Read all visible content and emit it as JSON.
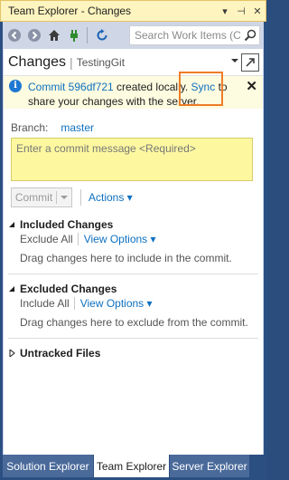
{
  "window": {
    "title": "Team Explorer - Changes",
    "controls": {
      "dropdown": "▾",
      "pin": "⊣",
      "close": "✕"
    }
  },
  "toolbar": {
    "buttons": [
      "back-icon",
      "forward-icon",
      "home-icon",
      "plug-icon",
      "refresh-icon"
    ],
    "search": {
      "placeholder": "Search Work Items (C",
      "icon": "search-icon"
    }
  },
  "header": {
    "page": "Changes",
    "separator": "|",
    "repo": "TestingGit"
  },
  "notification": {
    "prefix_link": "Commit 596df721",
    "middle": " created locally. ",
    "sync_link": "Sync",
    "suffix": " to share your changes with the server.",
    "close": "✕"
  },
  "branch": {
    "label": "Branch:",
    "value": "master"
  },
  "commit": {
    "placeholder": "Enter a commit message <Required>",
    "button": "Commit",
    "actions": "Actions ▾"
  },
  "included": {
    "title": "Included Changes",
    "exclude_all": "Exclude All",
    "view_options": "View Options ▾",
    "drop_text": "Drag changes here to include in the commit."
  },
  "excluded": {
    "title": "Excluded Changes",
    "include_all": "Include All",
    "view_options": "View Options ▾",
    "drop_text": "Drag changes here to exclude from the commit."
  },
  "untracked": {
    "title": "Untracked Files"
  },
  "tabs": [
    {
      "label": "Solution Explorer"
    },
    {
      "label": "Team Explorer"
    },
    {
      "label": "Server Explorer"
    }
  ],
  "colors": {
    "accent_link": "#0e70c0",
    "highlight_box": "#ee7d26",
    "commit_box": "#fdf8a0"
  }
}
